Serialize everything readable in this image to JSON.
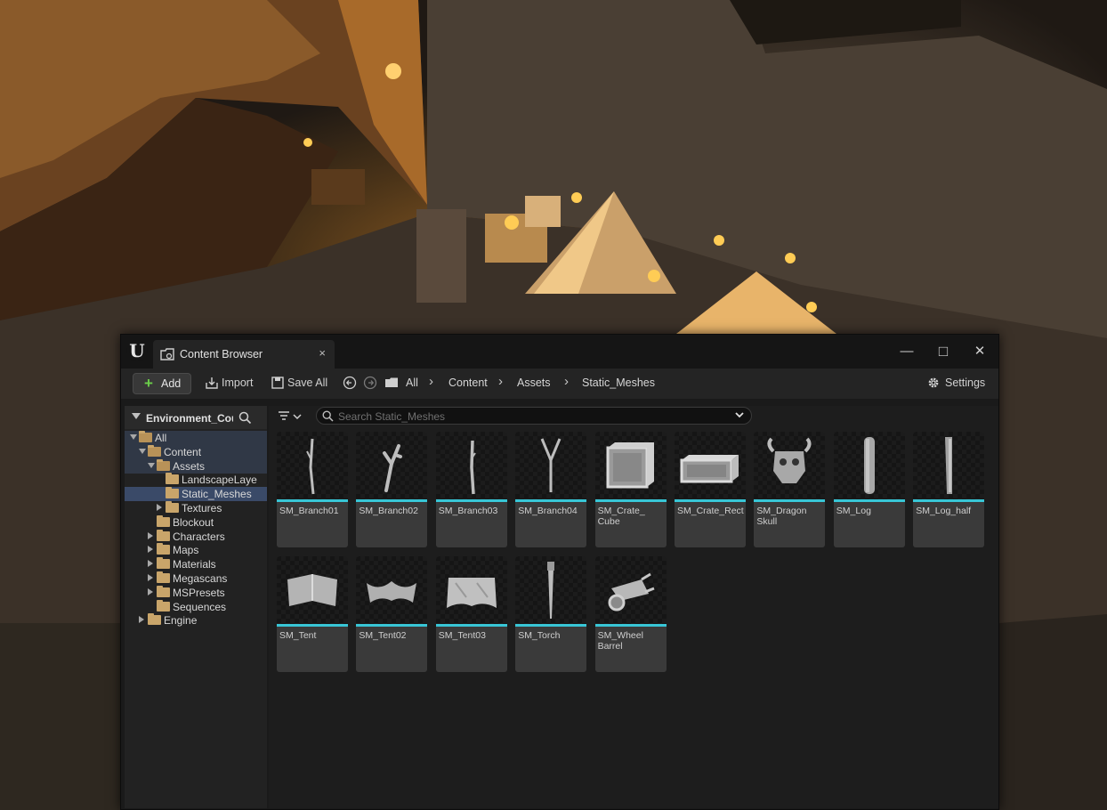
{
  "window": {
    "tab_label": "Content Browser",
    "tab_close": "×",
    "minimize": "—",
    "maximize": "□",
    "close": "✕"
  },
  "toolbar": {
    "add_label": "Add",
    "import_label": "Import",
    "save_all_label": "Save All",
    "settings_label": "Settings",
    "breadcrumbs": [
      "All",
      "Content",
      "Assets",
      "Static_Meshes"
    ],
    "separator": "›"
  },
  "sources": {
    "title": "Environment_Cou",
    "tree": [
      {
        "label": "All",
        "depth": 0,
        "expanded": true,
        "has_children": true
      },
      {
        "label": "Content",
        "depth": 1,
        "expanded": true,
        "has_children": true
      },
      {
        "label": "Assets",
        "depth": 2,
        "expanded": true,
        "has_children": true
      },
      {
        "label": "LandscapeLaye",
        "depth": 3,
        "expanded": false,
        "has_children": false
      },
      {
        "label": "Static_Meshes",
        "depth": 3,
        "expanded": false,
        "has_children": false,
        "selected": true
      },
      {
        "label": "Textures",
        "depth": 3,
        "expanded": false,
        "has_children": true
      },
      {
        "label": "Blockout",
        "depth": 2,
        "expanded": false,
        "has_children": false
      },
      {
        "label": "Characters",
        "depth": 2,
        "expanded": false,
        "has_children": true
      },
      {
        "label": "Maps",
        "depth": 2,
        "expanded": false,
        "has_children": true
      },
      {
        "label": "Materials",
        "depth": 2,
        "expanded": false,
        "has_children": true
      },
      {
        "label": "Megascans",
        "depth": 2,
        "expanded": false,
        "has_children": true
      },
      {
        "label": "MSPresets",
        "depth": 2,
        "expanded": false,
        "has_children": true
      },
      {
        "label": "Sequences",
        "depth": 2,
        "expanded": false,
        "has_children": false
      },
      {
        "label": "Engine",
        "depth": 1,
        "expanded": false,
        "has_children": true
      }
    ]
  },
  "search": {
    "placeholder": "Search Static_Meshes",
    "value": ""
  },
  "assets": [
    {
      "name": "SM_Branch01",
      "icon": "branch-mesh-icon"
    },
    {
      "name": "SM_Branch02",
      "icon": "branch-mesh-icon"
    },
    {
      "name": "SM_Branch03",
      "icon": "branch-mesh-icon"
    },
    {
      "name": "SM_Branch04",
      "icon": "branch-mesh-icon"
    },
    {
      "name": "SM_Crate_\nCube",
      "icon": "crate-cube-mesh-icon"
    },
    {
      "name": "SM_Crate_Rect",
      "icon": "crate-rect-mesh-icon"
    },
    {
      "name": "SM_Dragon\nSkull",
      "icon": "dragon-skull-mesh-icon"
    },
    {
      "name": "SM_Log",
      "icon": "log-mesh-icon"
    },
    {
      "name": "SM_Log_half",
      "icon": "log-half-mesh-icon"
    },
    {
      "name": "SM_Tent",
      "icon": "tent-mesh-icon"
    },
    {
      "name": "SM_Tent02",
      "icon": "tent-mesh-icon"
    },
    {
      "name": "SM_Tent03",
      "icon": "tent-mesh-icon"
    },
    {
      "name": "SM_Torch",
      "icon": "torch-mesh-icon"
    },
    {
      "name": "SM_Wheel\nBarrel",
      "icon": "wheelbarrow-mesh-icon"
    }
  ],
  "colors": {
    "static_mesh_accent": "#38c6d6",
    "selection": "#3a4a68",
    "add_plus": "#6bcf4a"
  }
}
